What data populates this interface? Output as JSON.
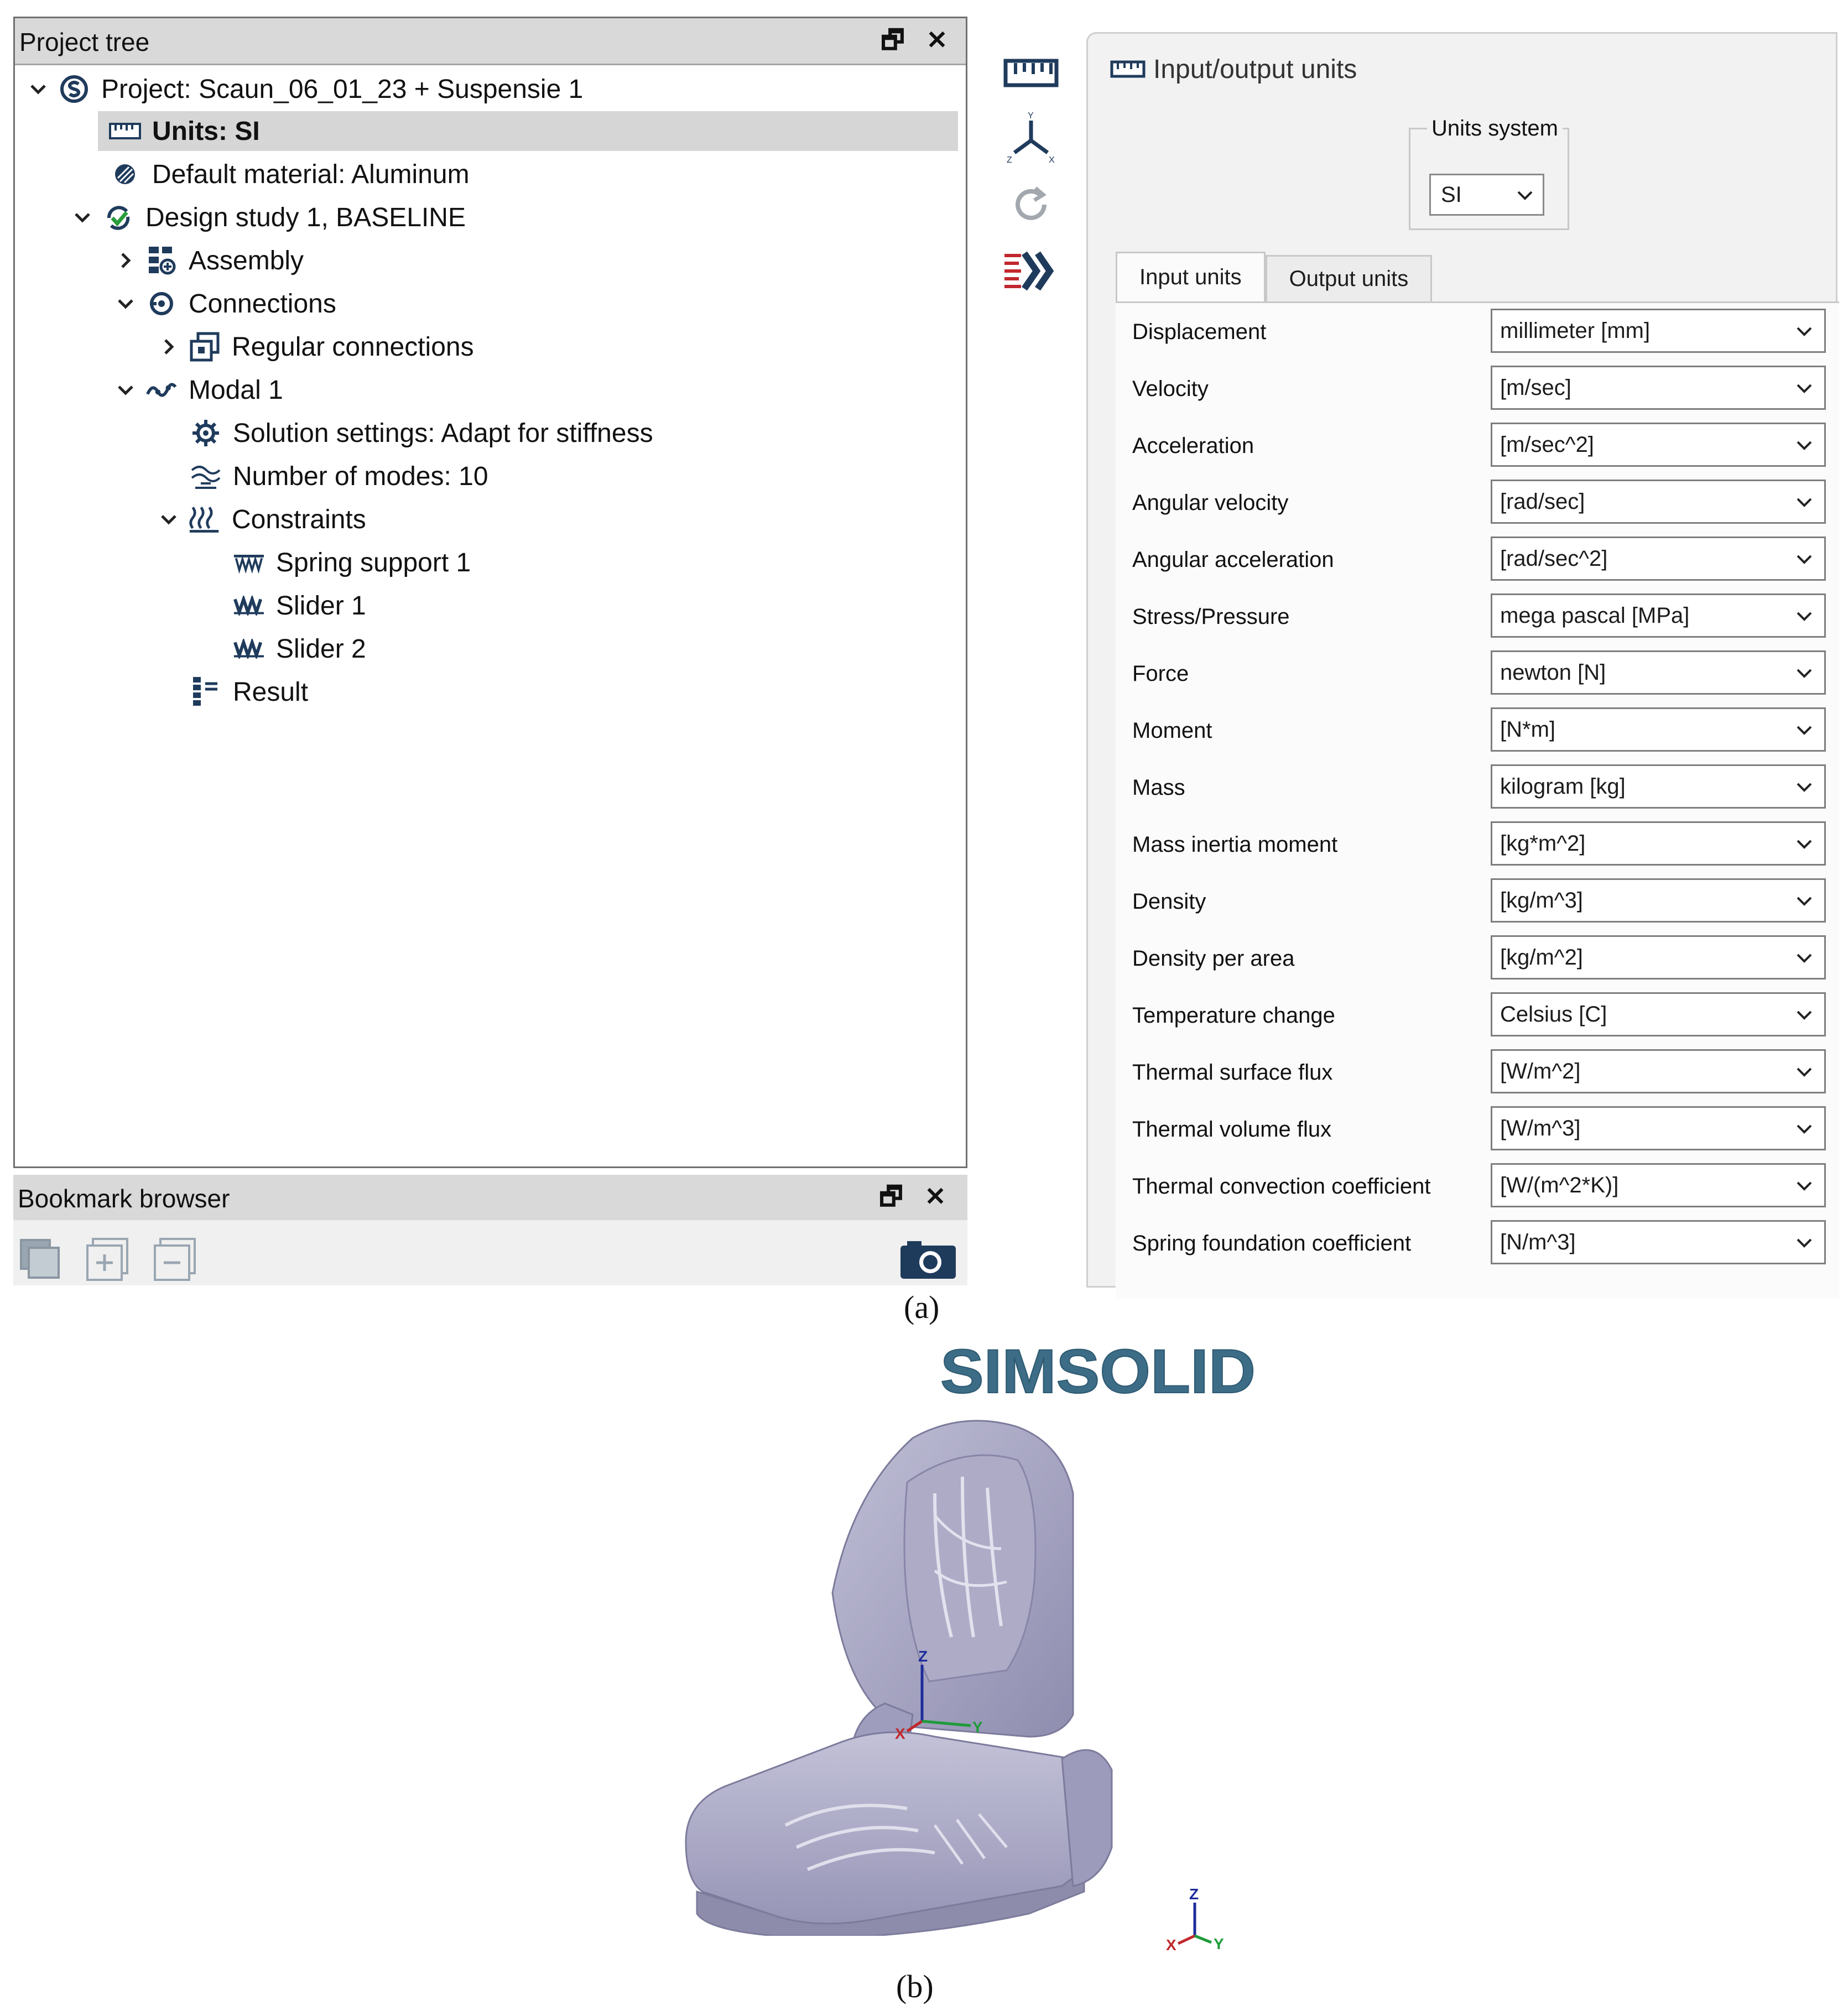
{
  "project_tree": {
    "title": "Project tree",
    "restore_glyph": "🗗",
    "close_glyph": "✕",
    "items": [
      {
        "label": "Project: Scaun_06_01_23 + Suspensie 1",
        "icon": "project-icon"
      },
      {
        "label": "Units: SI",
        "icon": "ruler-icon",
        "selected": true
      },
      {
        "label": "Default material: Aluminum",
        "icon": "material-icon"
      },
      {
        "label": "Design study 1, BASELINE",
        "icon": "design-study-icon"
      },
      {
        "label": "Assembly",
        "icon": "assembly-icon"
      },
      {
        "label": "Connections",
        "icon": "connections-icon"
      },
      {
        "label": "Regular connections",
        "icon": "regular-connections-icon"
      },
      {
        "label": "Modal 1",
        "icon": "modal-icon"
      },
      {
        "label": "Solution settings: Adapt for stiffness",
        "icon": "gear-icon"
      },
      {
        "label": "Number of modes: 10",
        "icon": "modes-icon"
      },
      {
        "label": "Constraints",
        "icon": "constraints-icon"
      },
      {
        "label": "Spring support 1",
        "icon": "spring-support-icon"
      },
      {
        "label": "Slider 1",
        "icon": "slider-icon"
      },
      {
        "label": "Slider 2",
        "icon": "slider-icon"
      },
      {
        "label": "Result",
        "icon": "result-icon"
      }
    ]
  },
  "bookmark_browser": {
    "title": "Bookmark browser",
    "restore_glyph": "🗗",
    "close_glyph": "✕",
    "icons": [
      "copy-bookmark-icon",
      "add-bookmark-icon",
      "remove-bookmark-icon",
      "camera-icon"
    ]
  },
  "toolbar": {
    "icons": [
      "units-ruler-icon",
      "axes-triad-icon",
      "refresh-icon",
      "run-arrows-icon"
    ]
  },
  "io_units": {
    "title": "Input/output units",
    "units_system_label": "Units system",
    "units_system_value": "SI",
    "tabs": [
      {
        "label": "Input units",
        "active": true
      },
      {
        "label": "Output units",
        "active": false
      }
    ],
    "rows": [
      {
        "label": "Displacement",
        "value": "millimeter [mm]"
      },
      {
        "label": "Velocity",
        "value": "[m/sec]"
      },
      {
        "label": "Acceleration",
        "value": "[m/sec^2]"
      },
      {
        "label": "Angular velocity",
        "value": "[rad/sec]"
      },
      {
        "label": "Angular acceleration",
        "value": "[rad/sec^2]"
      },
      {
        "label": "Stress/Pressure",
        "value": "mega pascal [MPa]"
      },
      {
        "label": "Force",
        "value": "newton [N]"
      },
      {
        "label": "Moment",
        "value": "[N*m]"
      },
      {
        "label": "Mass",
        "value": "kilogram [kg]"
      },
      {
        "label": "Mass inertia moment",
        "value": "[kg*m^2]"
      },
      {
        "label": "Density",
        "value": "[kg/m^3]"
      },
      {
        "label": "Density per area",
        "value": "[kg/m^2]"
      },
      {
        "label": "Temperature change",
        "value": "Celsius [C]"
      },
      {
        "label": "Thermal surface flux",
        "value": "[W/m^2]"
      },
      {
        "label": "Thermal volume flux",
        "value": "[W/m^3]"
      },
      {
        "label": "Thermal convection coefficient",
        "value": "[W/(m^2*K)]"
      },
      {
        "label": "Spring foundation coefficient",
        "value": "[N/m^3]"
      }
    ]
  },
  "captions": {
    "a": "(a)",
    "b": "(b)"
  },
  "logo_text": "SIMSOLID",
  "triad": {
    "x": "X",
    "y": "Y",
    "z": "Z"
  },
  "colors": {
    "logo": "#3d6c86",
    "seat": "#a9a8c4",
    "icon_navy": "#1f3b5c",
    "accent_red": "#c0282d",
    "check_green": "#2a9d3b"
  }
}
